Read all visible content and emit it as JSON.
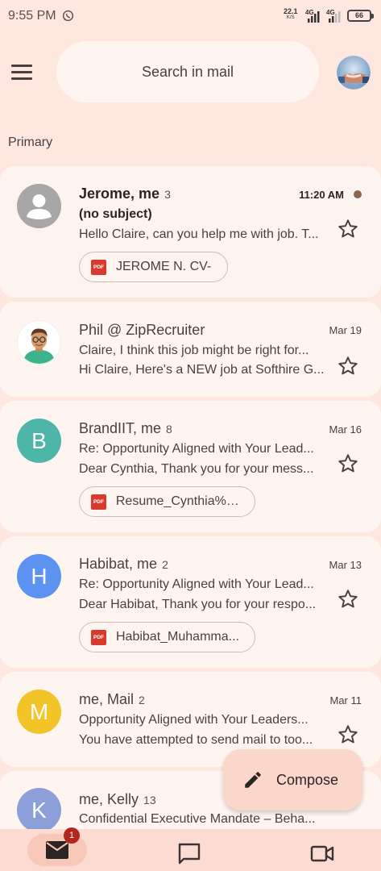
{
  "status_bar": {
    "time": "9:55 PM",
    "net_speed": "22.1",
    "net_unit": "K/S",
    "signal1": "4G",
    "signal2": "4G",
    "battery": "66"
  },
  "header": {
    "search_placeholder": "Search in mail"
  },
  "section": "Primary",
  "emails": [
    {
      "sender": "Jerome, me",
      "count": "3",
      "date": "11:20 AM",
      "subject": "(no subject)",
      "snippet": "Hello Claire, can you help me with job. T...",
      "attachment": "JEROME N. CV-",
      "unread": true
    },
    {
      "sender": "Phil @ ZipRecruiter",
      "count": "",
      "date": "Mar 19",
      "subject": "Claire, I think this job might be right for...",
      "snippet": "Hi Claire, Here's a NEW job at Softhire G...",
      "attachment": ""
    },
    {
      "sender": "BrandIIT, me",
      "count": "8",
      "date": "Mar 16",
      "initial": "B",
      "subject": "Re: Opportunity Aligned with Your Lead...",
      "snippet": "Dear Cynthia, Thank you for your mess...",
      "attachment": "Resume_Cynthia%2..."
    },
    {
      "sender": "Habibat, me",
      "count": "2",
      "date": "Mar 13",
      "initial": "H",
      "subject": "Re: Opportunity Aligned with Your Lead...",
      "snippet": "Dear Habibat, Thank you for your respo...",
      "attachment": "Habibat_Muhamma..."
    },
    {
      "sender": "me, Mail",
      "count": "2",
      "date": "Mar 11",
      "initial": "M",
      "subject": "Opportunity Aligned with Your Leaders...",
      "snippet": "You have attempted to send mail to too...",
      "attachment": ""
    },
    {
      "sender": "me, Kelly",
      "count": "13",
      "date": "",
      "initial": "K",
      "subject": "Confidential Executive Mandate – Beha...",
      "snippet": "",
      "attachment": ""
    }
  ],
  "avatar_colors": {
    "default": "#a8a6a6",
    "B": "#4db6a8",
    "H": "#5c93f0",
    "M": "#f3c428",
    "K": "#8c9fd8"
  },
  "compose": {
    "label": "Compose"
  },
  "bottom_nav": {
    "mail_badge": "1"
  }
}
